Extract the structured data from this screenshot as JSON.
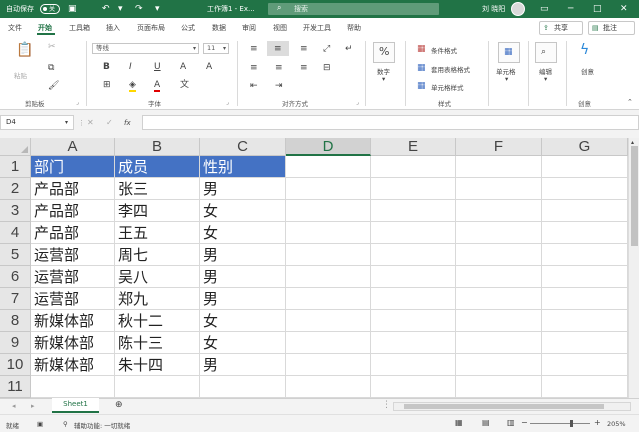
{
  "titlebar": {
    "autosave_label": "自动保存",
    "autosave_state": "关",
    "doc_title": "工作簿1 - Ex...",
    "search_placeholder": "搜索",
    "user": "刘 晓阳",
    "colors": {
      "brand": "#217346"
    }
  },
  "tabs": [
    {
      "label": "文件"
    },
    {
      "label": "开始",
      "active": true
    },
    {
      "label": "工具箱"
    },
    {
      "label": "插入"
    },
    {
      "label": "页面布局"
    },
    {
      "label": "公式"
    },
    {
      "label": "数据"
    },
    {
      "label": "审阅"
    },
    {
      "label": "视图"
    },
    {
      "label": "开发工具"
    },
    {
      "label": "帮助"
    }
  ],
  "share_label": "共享",
  "comments_label": "批注",
  "ribbon": {
    "clipboard": {
      "paste": "粘贴",
      "group": "剪贴板"
    },
    "font": {
      "name": "等线",
      "size": "11",
      "group": "字体"
    },
    "alignment": {
      "group": "对齐方式"
    },
    "number": {
      "label": "数字"
    },
    "styles": {
      "conditional": "条件格式",
      "table": "套用表格格式",
      "cell_styles": "单元格样式",
      "group": "样式"
    },
    "cells": {
      "label": "单元格"
    },
    "editing": {
      "label": "编辑"
    },
    "ideas": {
      "label": "创意",
      "group": "创意"
    }
  },
  "formula_bar": {
    "name_box": "D4",
    "formula": ""
  },
  "columns": [
    "A",
    "B",
    "C",
    "D",
    "E",
    "F",
    "G"
  ],
  "selected_column": "D",
  "rows": [
    [
      "部门",
      "成员",
      "性别"
    ],
    [
      "产品部",
      "张三",
      "男"
    ],
    [
      "产品部",
      "李四",
      "女"
    ],
    [
      "产品部",
      "王五",
      "女"
    ],
    [
      "运营部",
      "周七",
      "男"
    ],
    [
      "运营部",
      "吴八",
      "男"
    ],
    [
      "运营部",
      "郑九",
      "男"
    ],
    [
      "新媒体部",
      "秋十二",
      "女"
    ],
    [
      "新媒体部",
      "陈十三",
      "女"
    ],
    [
      "新媒体部",
      "朱十四",
      "男"
    ],
    [
      "",
      "",
      ""
    ]
  ],
  "row_numbers": [
    "1",
    "2",
    "3",
    "4",
    "5",
    "6",
    "7",
    "8",
    "9",
    "10",
    "11"
  ],
  "header_fill": "#4472c4",
  "sheet": {
    "tab_label": "Sheet1"
  },
  "status": {
    "ready": "就绪",
    "accessibility": "辅助功能: 一切就绪",
    "zoom": "205%"
  }
}
